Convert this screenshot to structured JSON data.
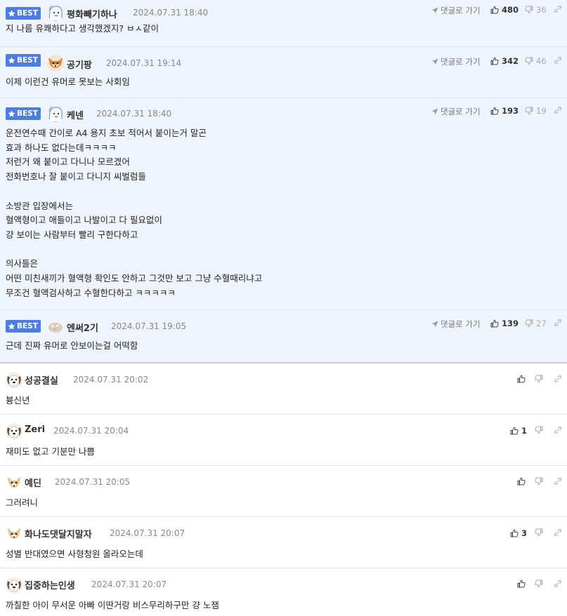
{
  "labels": {
    "best": "BEST",
    "reply": "댓글로 가기"
  },
  "colors": {
    "best_badge": "#4d7de0",
    "best_bg": "#eff3fb"
  },
  "comments": [
    {
      "best": true,
      "nick": "평화빼기하나",
      "date": "2024.07.31 18:40",
      "up": "480",
      "down": "36",
      "avatar": "blue-character-icon",
      "body": "지 나름 유쾌하다고 생각했겠지? ㅂㅅ같이"
    },
    {
      "best": true,
      "nick": "공기팡",
      "date": "2024.07.31 19:14",
      "up": "342",
      "down": "46",
      "avatar": "fox-character-icon",
      "body": "이제 이런건 유머로 못보는 사회임"
    },
    {
      "best": true,
      "nick": "케넨",
      "date": "2024.07.31 18:40",
      "up": "193",
      "down": "19",
      "avatar": "blue-character-icon",
      "body": "운전연수때 간이로 A4 용지 초보 적어서 붙이는거 말곤\n효과 하나도 없다는데ㅋㅋㅋㅋ\n저런거 왜 붙이고 다니나 모르겠어\n전화번호나 잘 붙이고 다니지 씨벌럼들\n\n소방관 입장에서는\n혈액형이고 애들이고 나발이고 다 필요없이\n걍 보이는 사람부터 빨리 구한다하고\n\n의사들은\n어떤 미친새끼가 혈액형 확인도 안하고 그것만 보고 그냥 수혈때리냐고\n무조건 혈액검사하고 수혈한다하고 ㅋㅋㅋㅋㅋ"
    },
    {
      "best": true,
      "nick": "엔써2기",
      "date": "2024.07.31 19:05",
      "up": "139",
      "down": "27",
      "avatar": "round-blob-icon",
      "body": "근데 진짜 유머로 안보이는걸 어떡함"
    },
    {
      "best": false,
      "nick": "성공결실",
      "date": "2024.07.31 20:02",
      "up": "",
      "down": "",
      "avatar": "dog-face-icon",
      "body": "븅신년"
    },
    {
      "best": false,
      "nick": "Zeri",
      "date": "2024.07.31 20:04",
      "up": "1",
      "down": "",
      "avatar": "dog-face-icon",
      "body": "재미도 없고 기분만 나쁨"
    },
    {
      "best": false,
      "nick": "예딘",
      "date": "2024.07.31 20:05",
      "up": "",
      "down": "",
      "avatar": "chihuahua-icon",
      "body": "그러려니"
    },
    {
      "best": false,
      "nick": "화나도댓달지말자",
      "date": "2024.07.31 20:07",
      "up": "3",
      "down": "",
      "avatar": "chihuahua-icon",
      "body": "성별 반대였으면 사형청원 올라오는데"
    },
    {
      "best": false,
      "nick": "집중하는인생",
      "date": "2024.07.31 20:07",
      "up": "",
      "down": "",
      "avatar": "dog-face-icon",
      "body": "까칠한 아이 무서운 아빠 이딴거랑 비스무리하구만 걍 노잼"
    }
  ]
}
